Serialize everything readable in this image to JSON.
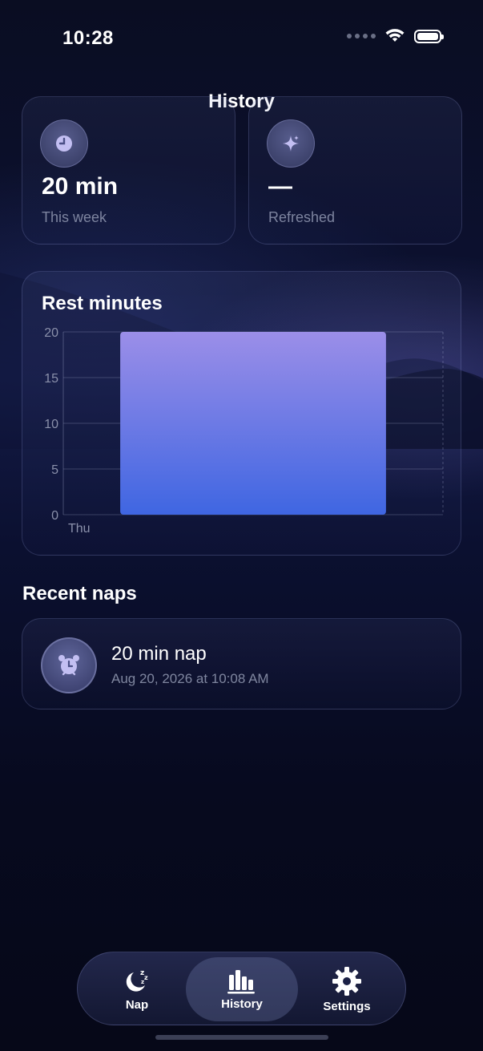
{
  "status_bar": {
    "time": "10:28"
  },
  "header": {
    "title": "History"
  },
  "stats": [
    {
      "icon": "clock-icon",
      "value": "20 min",
      "label": "This week"
    },
    {
      "icon": "sparkles-icon",
      "value": "—",
      "label": "Refreshed"
    }
  ],
  "chart": {
    "title": "Rest minutes"
  },
  "chart_data": {
    "type": "bar",
    "categories": [
      "Thu"
    ],
    "values": [
      20
    ],
    "ylim": [
      0,
      20
    ],
    "yticks": [
      0,
      5,
      10,
      15,
      20
    ],
    "grid": true,
    "colors": {
      "bar_top": "#9b8ee8",
      "bar_bottom": "#3f66e2"
    }
  },
  "recent": {
    "title": "Recent naps",
    "items": [
      {
        "icon": "alarm-clock-icon",
        "title": "20 min nap",
        "subtitle": "Aug 20, 2026 at 10:08 AM"
      }
    ]
  },
  "tabs": [
    {
      "label": "Nap",
      "icon": "moon-zzz-icon",
      "active": false
    },
    {
      "label": "History",
      "icon": "bar-chart-icon",
      "active": true
    },
    {
      "label": "Settings",
      "icon": "gear-icon",
      "active": false
    }
  ],
  "colors": {
    "accent": "#9b8ee8",
    "muted_text": "#7d849f"
  }
}
